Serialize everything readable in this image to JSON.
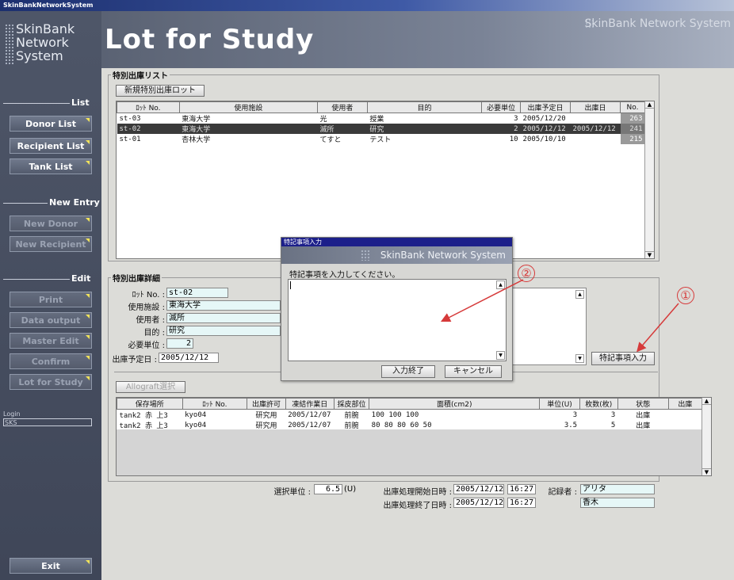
{
  "window_title": "SkinBankNetworkSystem",
  "brand": {
    "line1": "SkinBank",
    "line2": "Network",
    "line3": "System",
    "right": "SkinBank Network System"
  },
  "page_title": "Lot for Study",
  "sidebar": {
    "sections": [
      {
        "label": "List",
        "items": [
          {
            "label": "Donor List",
            "enabled": true
          },
          {
            "label": "Recipient List",
            "enabled": true
          },
          {
            "label": "Tank List",
            "enabled": true
          }
        ]
      },
      {
        "label": "New Entry",
        "items": [
          {
            "label": "New Donor",
            "enabled": false
          },
          {
            "label": "New Recipient",
            "enabled": false
          }
        ]
      },
      {
        "label": "Edit",
        "items": [
          {
            "label": "Print",
            "enabled": false
          },
          {
            "label": "Data output",
            "enabled": false
          },
          {
            "label": "Master Edit",
            "enabled": false
          },
          {
            "label": "Confirm",
            "enabled": false
          },
          {
            "label": "Lot for Study",
            "enabled": false
          }
        ]
      }
    ],
    "login_label": "Login",
    "login_value": "SKS",
    "exit_label": "Exit"
  },
  "list_section": {
    "title": "特別出庫リスト",
    "new_button": "新規特別出庫ロット",
    "columns": [
      "ﾛｯﾄ No.",
      "使用施設",
      "使用者",
      "目的",
      "必要単位",
      "出庫予定日",
      "出庫日",
      "No."
    ],
    "rows": [
      {
        "lot": "st-03",
        "facility": "東海大学",
        "user": "光",
        "purpose": "授業",
        "units": "3",
        "planned": "2005/12/20",
        "shipped": "",
        "no": "263",
        "selected": false
      },
      {
        "lot": "st-02",
        "facility": "東海大学",
        "user": "滅所",
        "purpose": "研究",
        "units": "2",
        "planned": "2005/12/12",
        "shipped": "2005/12/12",
        "no": "241",
        "selected": true
      },
      {
        "lot": "st-01",
        "facility": "杏林大学",
        "user": "てすと",
        "purpose": "テスト",
        "units": "10",
        "planned": "2005/10/10",
        "shipped": "",
        "no": "215",
        "selected": false
      }
    ]
  },
  "detail_section": {
    "title": "特別出庫詳細",
    "fields": [
      {
        "label": "ﾛｯﾄ No. :",
        "value": "st-02"
      },
      {
        "label": "使用施設 :",
        "value": "東海大学"
      },
      {
        "label": "使用者 :",
        "value": "滅所"
      },
      {
        "label": "目的 :",
        "value": "研究"
      },
      {
        "label": "必要単位 :",
        "value": "2"
      },
      {
        "label": "出庫予定日 :",
        "value": "2005/12/12"
      }
    ],
    "special_note_button": "特記事項入力",
    "allograft_button": "Allograft選択",
    "alloc_columns": [
      "保存場所",
      "ﾛｯﾄ No.",
      "出庫許可",
      "凍結作業日",
      "採皮部位",
      "面積(cm2)",
      "単位(U)",
      "枚数(枚)",
      "状態",
      "出庫"
    ],
    "alloc_rows": [
      {
        "place": "tank2 赤 上3",
        "lot": "kyo04",
        "permit": "研究用",
        "date": "2005/12/07",
        "site": "前腕",
        "area": "100 100 100",
        "units": "3",
        "count": "3",
        "status": "出庫"
      },
      {
        "place": "tank2 赤 上3",
        "lot": "kyo04",
        "permit": "研究用",
        "date": "2005/12/07",
        "site": "前腕",
        "area": "80 80 80 60 50",
        "units": "3.5",
        "count": "5",
        "status": "出庫"
      }
    ],
    "selected_units_label": "選択単位 :",
    "selected_units_value": "6.5",
    "selected_units_suffix": "(U)",
    "start_label": "出庫処理開始日時 :",
    "start_date": "2005/12/12",
    "start_time": "16:27",
    "end_label": "出庫処理終了日時 :",
    "end_date": "2005/12/12",
    "end_time": "16:27",
    "recorder_label": "記録者 :",
    "recorder1": "アリタ",
    "recorder2": "香木"
  },
  "dialog": {
    "title": "特記事項入力",
    "banner": "SkinBank Network System",
    "prompt": "特記事項を入力してください。",
    "ok_button": "入力終了",
    "cancel_button": "キャンセル"
  },
  "annotations": {
    "one": "①",
    "two": "②"
  },
  "colors": {
    "accent_yellow": "#f2e35a",
    "annotation_red": "#d63a3a",
    "dialog_title": "#1c1f8a"
  }
}
